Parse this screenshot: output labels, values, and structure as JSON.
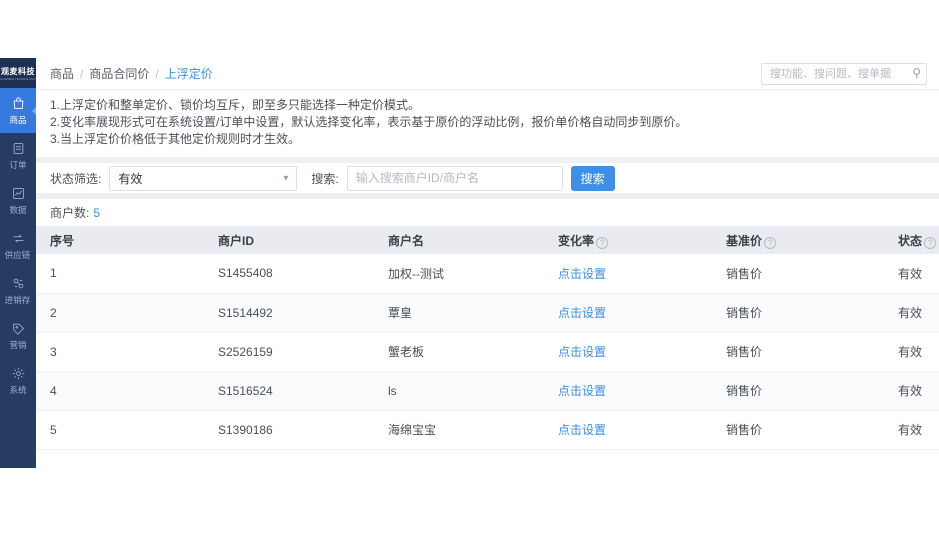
{
  "brand": {
    "logo_text": "观麦科技"
  },
  "sidebar": {
    "items": [
      {
        "label": "商品",
        "icon": "goods-icon",
        "active": true
      },
      {
        "label": "订单",
        "icon": "orders-icon",
        "active": false
      },
      {
        "label": "数据",
        "icon": "data-chart-icon",
        "active": false
      },
      {
        "label": "供应链",
        "icon": "supply-chain-icon",
        "active": false
      },
      {
        "label": "进销存",
        "icon": "inventory-icon",
        "active": false
      },
      {
        "label": "营销",
        "icon": "marketing-tag-icon",
        "active": false
      },
      {
        "label": "系统",
        "icon": "system-gear-icon",
        "active": false
      }
    ]
  },
  "breadcrumb": {
    "items": [
      "商品",
      "商品合同价",
      "上浮定价"
    ],
    "separator": "/"
  },
  "topbar_search": {
    "placeholder": "搜功能、搜问题、搜单据",
    "icon": "search-icon"
  },
  "notes": {
    "line1": "1.上浮定价和整单定价、锁价均互斥，即至多只能选择一种定价模式。",
    "line2": "2.变化率展现形式可在系统设置/订单中设置，默认选择变化率，表示基于原价的浮动比例，报价单价格自动同步到原价。",
    "line3": "3.当上浮定价价格低于其他定价规则时才生效。"
  },
  "filters": {
    "status_label": "状态筛选:",
    "status_value": "有效",
    "search_label": "搜索:",
    "search_placeholder": "输入搜索商户ID/商户名",
    "search_button": "搜索"
  },
  "summary": {
    "label": "商户数:",
    "count": "5"
  },
  "table": {
    "headers": [
      {
        "label": "序号",
        "help": false
      },
      {
        "label": "商户ID",
        "help": false
      },
      {
        "label": "商户名",
        "help": false
      },
      {
        "label": "变化率",
        "help": true
      },
      {
        "label": "基准价",
        "help": true
      },
      {
        "label": "状态",
        "help": true
      }
    ],
    "rows": [
      {
        "index": "1",
        "merchant_id": "S1455408",
        "merchant_name": "加权--测试",
        "change_rate": "点击设置",
        "base_price": "销售价",
        "status": "有效"
      },
      {
        "index": "2",
        "merchant_id": "S1514492",
        "merchant_name": "覃皇",
        "change_rate": "点击设置",
        "base_price": "销售价",
        "status": "有效"
      },
      {
        "index": "3",
        "merchant_id": "S2526159",
        "merchant_name": "蟹老板",
        "change_rate": "点击设置",
        "base_price": "销售价",
        "status": "有效"
      },
      {
        "index": "4",
        "merchant_id": "S1516524",
        "merchant_name": "ls",
        "change_rate": "点击设置",
        "base_price": "销售价",
        "status": "有效"
      },
      {
        "index": "5",
        "merchant_id": "S1390186",
        "merchant_name": "海绵宝宝",
        "change_rate": "点击设置",
        "base_price": "销售价",
        "status": "有效"
      }
    ]
  },
  "colors": {
    "sidebar_bg": "#263c60",
    "sidebar_active": "#3679df",
    "link_blue": "#3a8ee6",
    "button_blue": "#3d8fe8",
    "table_header_bg": "#e9ebf0"
  }
}
